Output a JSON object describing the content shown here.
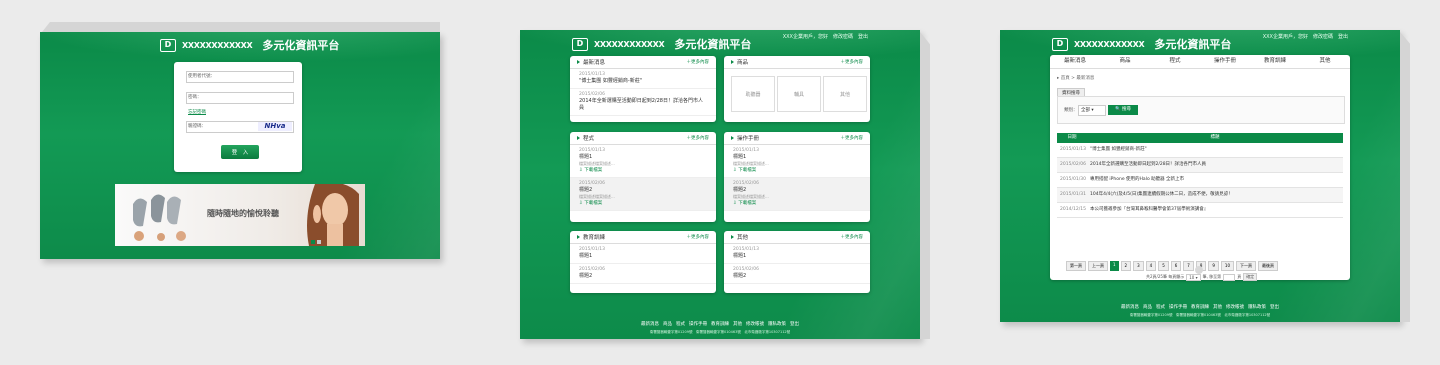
{
  "company_name": "XXXXXXXXXXXX",
  "platform_title": "多元化資訊平台",
  "login": {
    "username_label": "使用者代號：",
    "password_label": "密碼：",
    "forgot_label": "忘記密碼",
    "captcha_label": "驗證碼：",
    "captcha_text": "NHva",
    "login_button": "登　入",
    "banner_text": "隨時隨地的愉悅聆聽"
  },
  "top_links": [
    "XXX企業用戶，您好",
    "修改密碼",
    "登出"
  ],
  "more_label": "＋更多內容",
  "download_label": "下載檔案",
  "dashboard": {
    "news": {
      "title": "最新消息",
      "items": [
        {
          "date": "2015/01/13",
          "text": "\"博士集團 如豐經銷商-新莊\""
        },
        {
          "date": "2015/02/06",
          "text": "2014年全新選購至活動即日起到2/28日！詳洽各門市人員"
        }
      ]
    },
    "products": {
      "title": "商品",
      "boxes": [
        "助聽器",
        "輔具",
        "其他"
      ]
    },
    "programs": {
      "title": "程式",
      "items": [
        {
          "date": "2015/01/13",
          "text": "標題1",
          "sub": "檔案描述檔案描述..."
        },
        {
          "date": "2015/02/06",
          "text": "標題2",
          "sub": "檔案描述檔案描述..."
        }
      ]
    },
    "manuals": {
      "title": "操作手冊",
      "items": [
        {
          "date": "2015/01/13",
          "text": "標題1",
          "sub": "檔案描述檔案描述..."
        },
        {
          "date": "2015/02/06",
          "text": "標題2",
          "sub": "檔案描述檔案描述..."
        }
      ]
    },
    "training": {
      "title": "教育訓練",
      "items": [
        {
          "date": "2015/01/13",
          "text": "標題1"
        },
        {
          "date": "2015/02/06",
          "text": "標題2"
        }
      ]
    },
    "others": {
      "title": "其他",
      "items": [
        {
          "date": "2015/01/13",
          "text": "標題1"
        },
        {
          "date": "2015/02/06",
          "text": "標題2"
        }
      ]
    }
  },
  "footer": {
    "links": [
      "最新消息",
      "商品",
      "程式",
      "操作手冊",
      "教育訓練",
      "其他",
      "修改帳號",
      "隱私政策",
      "登出"
    ],
    "reg1": "衛署醫器輸壹字第01209號",
    "reg2": "衛署醫器輸壹字第010463號",
    "reg3": "北市衛器販字第10307112號"
  },
  "listing": {
    "nav": [
      "最新消息",
      "商品",
      "程式",
      "操作手冊",
      "教育訓練",
      "其他"
    ],
    "breadcrumb": "首頁 > 最新消息",
    "tab": "資料搜尋",
    "category_label": "類別：",
    "category_value": "全部",
    "search_button": "搜尋",
    "col_date": "日期",
    "col_title": "標題",
    "rows": [
      {
        "date": "2015/01/13",
        "title": "\"博士集團 如豐經銷商-新莊\""
      },
      {
        "date": "2015/02/06",
        "title": "2014年全新選購至活動即日起到2/28日！詳洽各門市人員"
      },
      {
        "date": "2015/01/30",
        "title": "專用搭配 iPhone 使用的Halo 助聽器 全新上市"
      },
      {
        "date": "2015/01/31",
        "title": "104年4/4(六)及4/5(日)集團連續假期公休二日，造成不便，敬請見諒！"
      },
      {
        "date": "2014/12/15",
        "title": "本公司獲邀參加『台灣耳鼻喉科醫學會第37屆學術演講會』"
      }
    ],
    "pager": {
      "first": "第一頁",
      "prev": "上一頁",
      "pages": [
        "1",
        "2",
        "3",
        "4",
        "5",
        "6",
        "7",
        "8",
        "9",
        "10"
      ],
      "next": "下一頁",
      "last": "最後頁",
      "info": "共2頁/25筆 每頁顯示",
      "per_page": "10",
      "jump": "筆, 移至第",
      "page_unit": "頁",
      "go": "確定"
    }
  }
}
